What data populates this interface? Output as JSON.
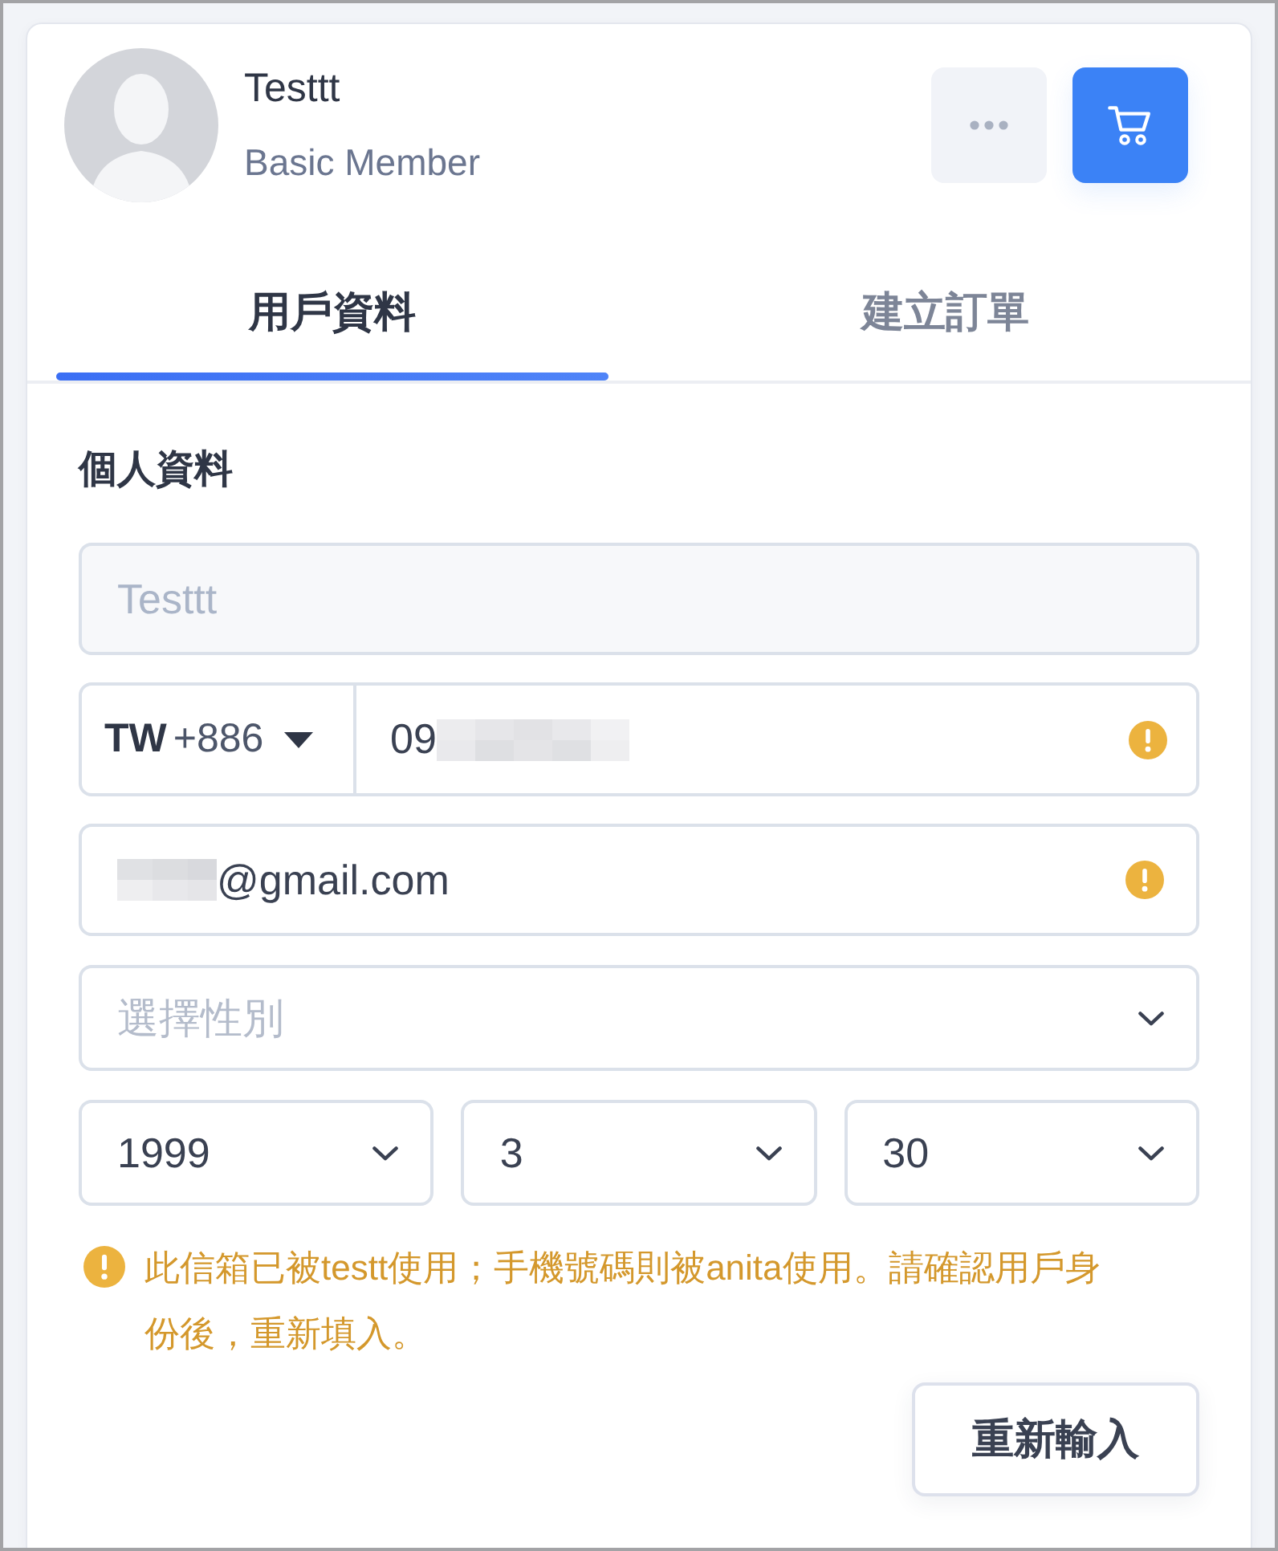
{
  "header": {
    "name": "Testtt",
    "membership": "Basic Member"
  },
  "tabs": [
    {
      "label": "用戶資料",
      "selected": true
    },
    {
      "label": "建立訂單",
      "selected": false
    }
  ],
  "form": {
    "title": "個人資料",
    "name_field": {
      "value": "Testtt",
      "disabled": true
    },
    "phone_field": {
      "country": "TW",
      "dial_code": "+886",
      "value": "09",
      "redacted": true,
      "warning": true
    },
    "email_field": {
      "value": "@gmail.com",
      "redacted": true,
      "warning": true
    },
    "gender_select": {
      "placeholder": "選擇性別"
    },
    "birth_date": [
      {
        "value": "1999"
      },
      {
        "value": "3"
      },
      {
        "value": "30"
      }
    ],
    "error": {
      "message": "此信箱已被testt使用；手機號碼則被anita使用。請確認用戶身份後，重新填入。"
    },
    "reset_button": {
      "label": "重新輸入"
    }
  }
}
